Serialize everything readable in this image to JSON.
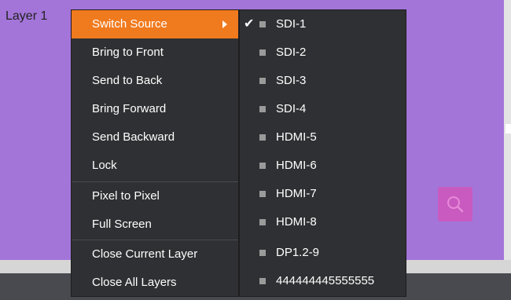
{
  "layer": {
    "label": "Layer 1"
  },
  "context_menu": {
    "items": [
      {
        "label": "Switch Source"
      },
      {
        "label": "Bring to Front"
      },
      {
        "label": "Send to Back"
      },
      {
        "label": "Bring Forward"
      },
      {
        "label": "Send Backward"
      },
      {
        "label": "Lock"
      },
      {
        "label": "Pixel to Pixel"
      },
      {
        "label": "Full Screen"
      },
      {
        "label": "Close Current Layer"
      },
      {
        "label": "Close All Layers"
      }
    ],
    "active_item": "Switch Source"
  },
  "source_submenu": {
    "selected": "SDI-1",
    "items": [
      {
        "label": "SDI-1"
      },
      {
        "label": "SDI-2"
      },
      {
        "label": "SDI-3"
      },
      {
        "label": "SDI-4"
      },
      {
        "label": "HDMI-5"
      },
      {
        "label": "HDMI-6"
      },
      {
        "label": "HDMI-7"
      },
      {
        "label": "HDMI-8"
      },
      {
        "label": "DP1.2-9"
      },
      {
        "label": "444444445555555"
      }
    ]
  },
  "colors": {
    "layer_bg": "#a375d9",
    "menu_bg": "#2f3033",
    "active_item": "#f07a1e",
    "zoom_button": "#c85ac0"
  },
  "icons": {
    "submenu_arrow": "chevron-right-icon",
    "selected_mark": "checkmark-icon",
    "source_bullet": "square-bullet-icon",
    "zoom": "search-icon"
  }
}
